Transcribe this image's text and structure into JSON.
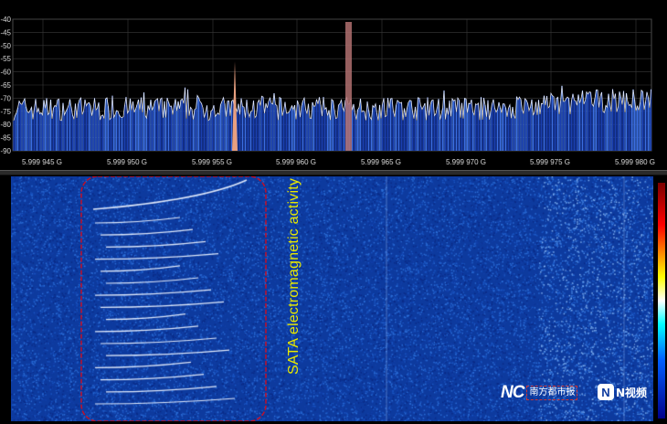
{
  "spectrum": {
    "y_axis": {
      "tick_labels": [
        "-40",
        "-45",
        "-50",
        "-55",
        "-60",
        "-65",
        "-70",
        "-75",
        "-80",
        "-85",
        "-90"
      ],
      "range_dbm": [
        -90,
        -40
      ]
    },
    "x_axis": {
      "tick_labels": [
        "5.999 945 G",
        "5.999 950 G",
        "5.999 955 G",
        "5.999 960 G",
        "5.999 965 G",
        "5.999 970 G",
        "5.999 975 G",
        "5.999 980 G"
      ]
    },
    "noise_floor_dbm": -74,
    "peaks": [
      {
        "frequency_label": "5.999 956 G",
        "level_dbm": -56
      },
      {
        "frequency_label": "5.999 963 G",
        "level_dbm": -40
      }
    ],
    "colors": {
      "background": "#000000",
      "grid": "#3a3a3a",
      "bars": "#1a3fb0",
      "bars_bright": "#3a6de0",
      "trace": "#ffffff",
      "peak_marker": "#e8a080"
    }
  },
  "waterfall": {
    "annotation": "SATA electromagnetic activity",
    "highlight_color": "#c0102a",
    "background_color": "#0d3a9e"
  },
  "colorbar": {
    "colors": [
      "#7a0000",
      "#ff0000",
      "#ff8c00",
      "#ffff00",
      "#ffffff",
      "#00ffff",
      "#0060ff",
      "#00008b"
    ]
  },
  "watermarks": {
    "left_logo_icon": "NC",
    "left_text": "南方都市报",
    "right_logo_icon": "N",
    "right_text": "N视频"
  }
}
